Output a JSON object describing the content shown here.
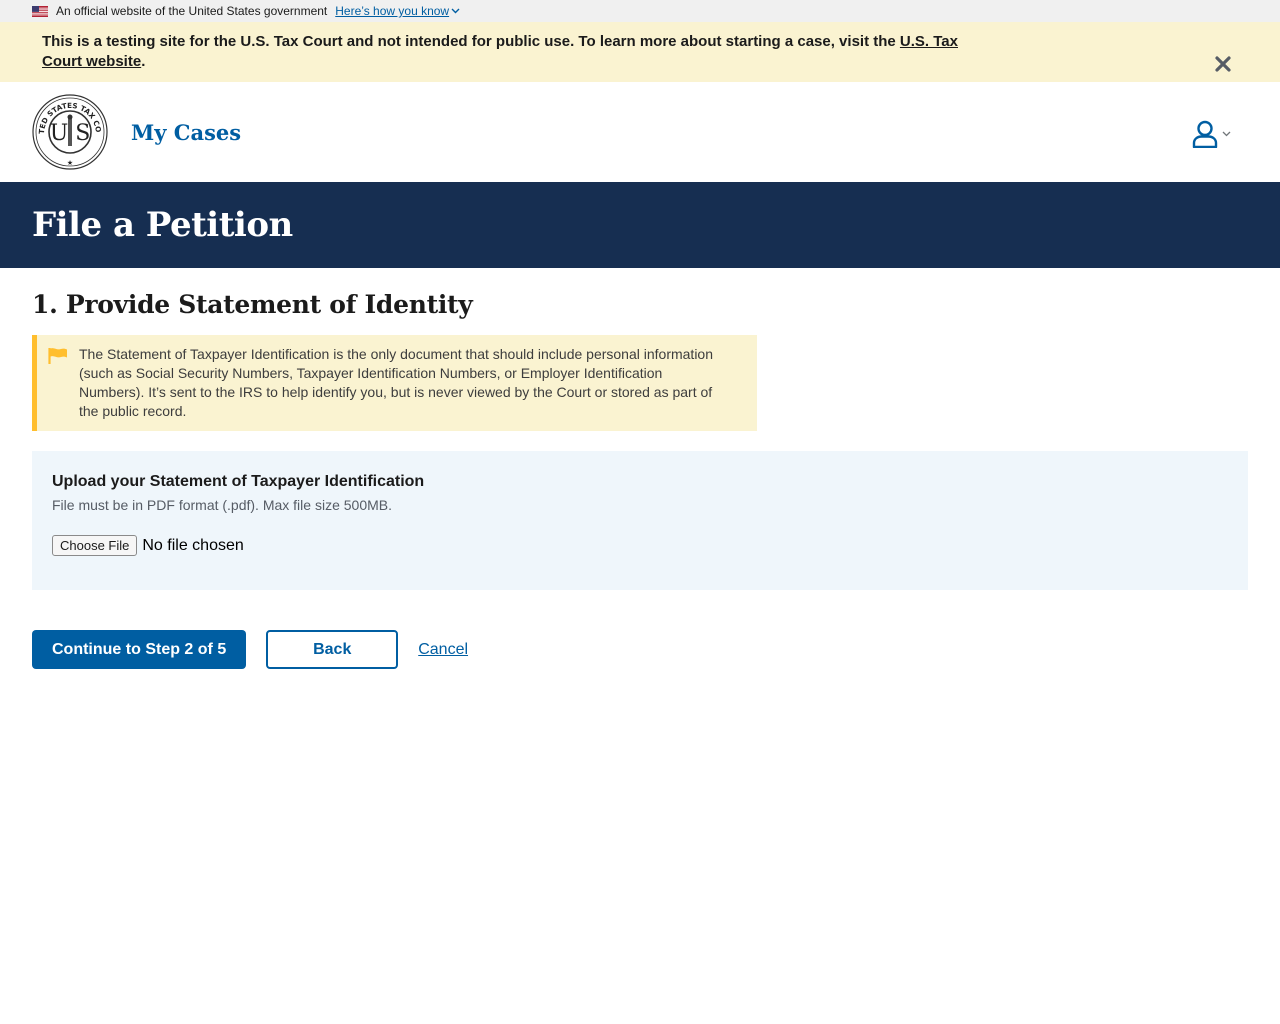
{
  "gov_banner": {
    "text": "An official website of the United States government",
    "link": "Here’s how you know"
  },
  "test_alert": {
    "text": "This is a testing site for the U.S. Tax Court and not intended for public use. To learn more about starting a case, visit the ",
    "link": "U.S. Tax Court website",
    "suffix": "."
  },
  "header": {
    "title": "My Cases"
  },
  "page": {
    "title": "File a Petition",
    "step_heading": "1. Provide Statement of Identity"
  },
  "warning": {
    "text": "The Statement of Taxpayer Identification is the only document that should include personal information (such as Social Security Numbers, Taxpayer Identification Numbers, or Employer Identification Numbers). It’s sent to the IRS to help identify you, but is never viewed by the Court or stored as part of the public record."
  },
  "upload": {
    "label": "Upload your Statement of Taxpayer Identification",
    "hint": "File must be in PDF format (.pdf). Max file size 500MB.",
    "button": "Choose File",
    "status": "No file chosen"
  },
  "actions": {
    "continue": "Continue to Step 2 of 5",
    "back": "Back",
    "cancel": "Cancel"
  },
  "colors": {
    "primary": "#005ea2",
    "title_band": "#162e51",
    "alert_bg": "#faf3d1",
    "warning_border": "#ffbe2e",
    "upload_bg": "#eff6fb"
  }
}
